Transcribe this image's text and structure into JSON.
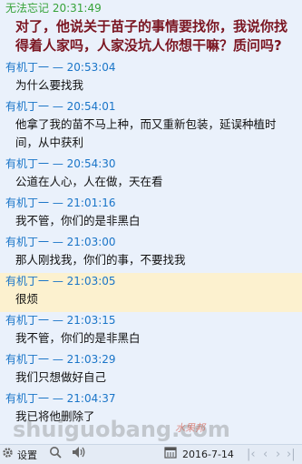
{
  "messages": [
    {
      "sender": "无法忘记",
      "time": "20:31:49",
      "text": "对了，他说关于苗子的事情要找你，我说你找得着人家吗，人家没坑人你想干嘛？质问吗?",
      "style": "big"
    },
    {
      "sender": "有机丁一",
      "time": "20:53:04",
      "text": "为什么要找我"
    },
    {
      "sender": "有机丁一",
      "time": "20:54:01",
      "text": "他拿了我的苗不马上种，而又重新包装，延误种植时间，从中获利"
    },
    {
      "sender": "有机丁一",
      "time": "20:54:30",
      "text": "公道在人心，人在做，天在看"
    },
    {
      "sender": "有机丁一",
      "time": "21:01:16",
      "text": "我不管，你们的是非黑白"
    },
    {
      "sender": "有机丁一",
      "time": "21:03:00",
      "text": "那人刚找我，你们的事，不要找我"
    },
    {
      "sender": "有机丁一",
      "time": "21:03:05",
      "text": "很烦",
      "highlight": true
    },
    {
      "sender": "有机丁一",
      "time": "21:03:15",
      "text": "我不管，你们的是非黑白"
    },
    {
      "sender": "有机丁一",
      "time": "21:03:29",
      "text": "我们只想做好自己"
    },
    {
      "sender": "有机丁一",
      "time": "21:04:37",
      "text": "我已将他删除了"
    }
  ],
  "footer": {
    "settings_label": "设置",
    "date": "2016-7-14",
    "settings_icon": "gear-icon",
    "search_icon": "search-icon",
    "sound_icon": "speaker-icon",
    "calendar_icon": "calendar-icon",
    "first_icon": "first-page-icon",
    "prev_icon": "prev-page-icon",
    "next_icon": "next-page-icon",
    "last_icon": "last-page-icon"
  },
  "watermark": {
    "text": "shuiguobang.com",
    "cn": "水果邦"
  },
  "colors": {
    "sender_blue": "#1a75c8",
    "sender_green": "#37a33a",
    "highlight": "#fcf1cf",
    "big_text": "#7b1622",
    "background": "#eaf1fb"
  }
}
